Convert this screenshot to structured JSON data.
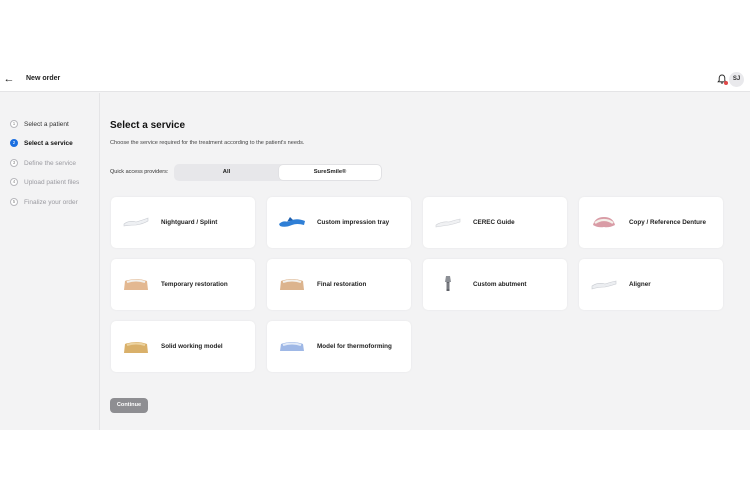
{
  "header": {
    "title": "New order",
    "avatar_initials": "SJ"
  },
  "steps": [
    {
      "num": "1",
      "label": "Select a patient",
      "state": "done"
    },
    {
      "num": "2",
      "label": "Select a service",
      "state": "active"
    },
    {
      "num": "3",
      "label": "Define the service",
      "state": "pending"
    },
    {
      "num": "4",
      "label": "Upload patient files",
      "state": "pending"
    },
    {
      "num": "5",
      "label": "Finalize your order",
      "state": "pending"
    }
  ],
  "main": {
    "title": "Select a service",
    "subtitle": "Choose the service required for the treatment according to the patient's needs.",
    "quick_access_label": "Quick access providers:",
    "providers": [
      "All",
      "SureSmile®"
    ],
    "selected_provider": "SureSmile®",
    "services": [
      {
        "label": "Nightguard / Splint",
        "icon": "clear-splint-icon"
      },
      {
        "label": "Custom impression tray",
        "icon": "impression-tray-icon"
      },
      {
        "label": "CEREC Guide",
        "icon": "cerec-guide-icon"
      },
      {
        "label": "Copy / Reference Denture",
        "icon": "denture-icon"
      },
      {
        "label": "Temporary restoration",
        "icon": "temporary-restoration-icon"
      },
      {
        "label": "Final restoration",
        "icon": "final-restoration-icon"
      },
      {
        "label": "Custom abutment",
        "icon": "abutment-icon"
      },
      {
        "label": "Aligner",
        "icon": "aligner-icon"
      },
      {
        "label": "Solid working model",
        "icon": "working-model-icon"
      },
      {
        "label": "Model for thermoforming",
        "icon": "thermoforming-model-icon"
      }
    ],
    "continue_label": "Continue"
  },
  "colors": {
    "accent": "#1b6fe0",
    "notification": "#e04848",
    "disabled_button": "#8e8e92"
  }
}
